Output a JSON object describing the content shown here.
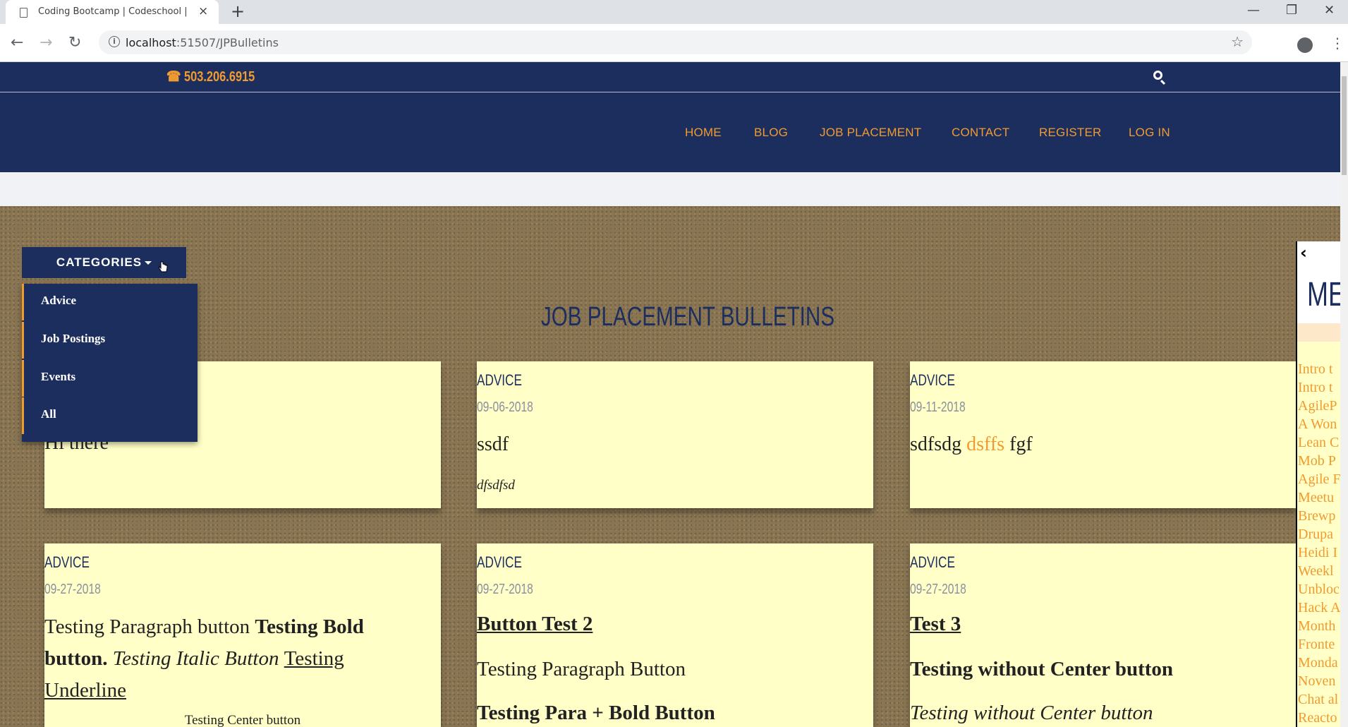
{
  "browser": {
    "tab_title": "Coding Bootcamp | Codeschool |",
    "new_tab": "+",
    "close_tab": "×",
    "url_host": "localhost",
    "url_rest": ":51507/JPBulletins",
    "win_min": "—",
    "win_max": "❐",
    "win_close": "✕"
  },
  "header": {
    "phone": "503.206.6915",
    "nav": [
      "HOME",
      "BLOG",
      "JOB PLACEMENT",
      "CONTACT",
      "REGISTER",
      "LOG IN"
    ]
  },
  "categories": {
    "button_label": "CATEGORIES",
    "items": [
      "Advice",
      "Job Postings",
      "Events",
      "All"
    ]
  },
  "board": {
    "title": "JOB PLACEMENT BULLETINS",
    "cards": [
      {
        "body": "Hi there"
      },
      {
        "category": "ADVICE",
        "date": "09-06-2018",
        "heading": "ssdf",
        "italic": "dfsdfsd"
      },
      {
        "category": "ADVICE",
        "date": "09-11-2018",
        "pre": "sdfsdg ",
        "link": "dsffs",
        "post": " fgf"
      },
      {
        "category": "ADVICE",
        "date": "09-27-2018",
        "p1": "Testing Paragraph button ",
        "bold": "Testing Bold button.",
        "italic": " Testing Italic Button ",
        "underline": "Testing Underline",
        "center": "Testing Center button"
      },
      {
        "category": "ADVICE",
        "date": "09-27-2018",
        "heading": "Button Test 2",
        "para": "Testing Paragraph Button",
        "bold": "Testing Para + Bold Button"
      },
      {
        "category": "ADVICE",
        "date": "09-27-2018",
        "heading": "Test 3",
        "bold": "Testing without Center button",
        "italic": "Testing without Center button"
      }
    ]
  },
  "side_panel": {
    "heading": "ME",
    "links": [
      "Intro t",
      "Intro t",
      "AgileP",
      "A Won",
      "Lean C",
      "Mob P",
      "Agile F",
      "Meetu",
      "Brewp",
      "Drupa",
      "Heidi I",
      "Weekl",
      "Unbloc",
      "Hack A",
      "Month",
      "Fronte",
      "Monda",
      "Noven",
      "Chat al",
      "Reacto"
    ]
  },
  "colors": {
    "navy": "#1c2e5e",
    "orange": "#f19a2f",
    "note": "#ffffc7"
  }
}
